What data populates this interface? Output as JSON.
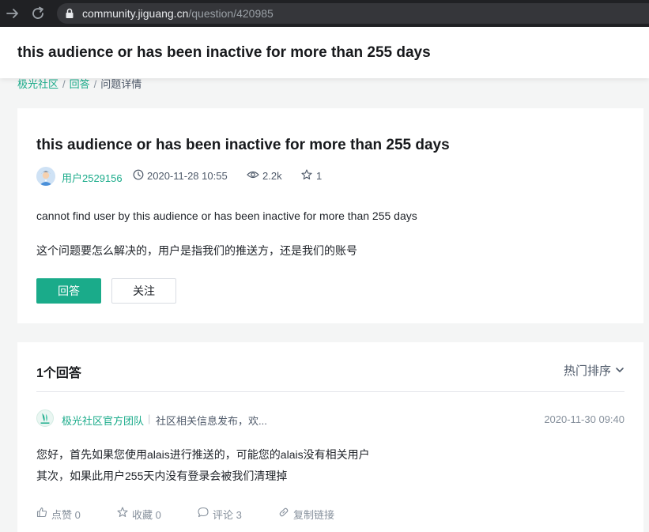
{
  "browser": {
    "url_host": "community.jiguang.cn",
    "url_path": "/question/420985"
  },
  "sticky_header": {
    "title": "this audience or has been inactive for more than 255 days"
  },
  "breadcrumb": [
    {
      "label": "极光社区"
    },
    {
      "label": "回答"
    },
    {
      "label": "问题详情"
    }
  ],
  "breadcrumb_separator": "/",
  "question": {
    "title": "this audience or has been inactive for more than 255 days",
    "author": "用户2529156",
    "time": "2020-11-28 10:55",
    "views": "2.2k",
    "stars": "1",
    "body_line_1": "cannot find user by this audience or has been inactive for more than 255 days",
    "body_line_2": "这个问题要怎么解决的，用户是指我们的推送方，还是我们的账号",
    "answer_button": "回答",
    "follow_button": "关注"
  },
  "answers": {
    "count_label": "1个回答",
    "sort_label": "热门排序",
    "items": [
      {
        "author": "极光社区官方团队",
        "separator": "|",
        "description": "社区相关信息发布，欢...",
        "time": "2020-11-30 09:40",
        "body_line_1": "您好，首先如果您使用alais进行推送的，可能您的alais没有相关用户",
        "body_line_2": "其次，如果此用户255天内没有登录会被我们清理掉",
        "actions": {
          "like": "点赞 0",
          "collect": "收藏 0",
          "comment": "评论 3",
          "copy_link": "复制链接"
        }
      }
    ]
  },
  "colors": {
    "brand_green": "#1aab8a",
    "browser_bar": "#202124",
    "page_bg": "#f4f5f5"
  },
  "icons": [
    "arrow-right-icon",
    "reload-icon",
    "lock-icon",
    "clock-icon",
    "eye-icon",
    "star-icon",
    "chevron-down-icon",
    "thumbs-up-icon",
    "comment-icon",
    "link-icon"
  ]
}
